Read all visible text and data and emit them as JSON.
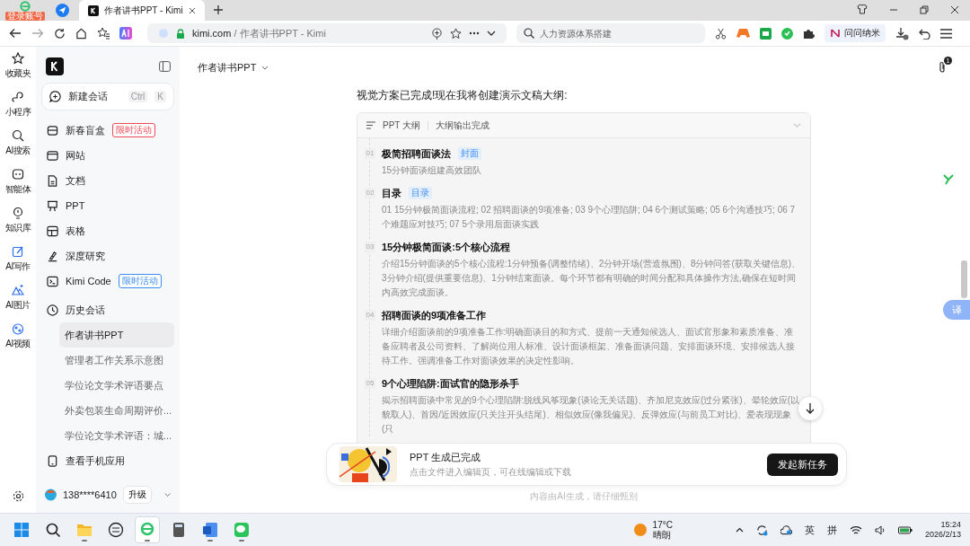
{
  "browser": {
    "tabs": [
      {
        "kind": "icon",
        "badge": "登录账号",
        "selected": false
      },
      {
        "kind": "icon",
        "selected": false
      },
      {
        "kind": "page",
        "label": "作者讲书PPT - Kimi",
        "selected": true
      }
    ],
    "address": {
      "host": "kimi.com",
      "path": " / 作者讲书PPT - Kimi"
    },
    "search": {
      "placeholder": "人力资源体系搭建"
    },
    "extension": "问问纳米"
  },
  "rail": [
    {
      "label": "收藏夹",
      "highlighted": false
    },
    {
      "label": "小程序",
      "highlighted": false
    },
    {
      "label": "AI搜索",
      "highlighted": false
    },
    {
      "label": "智能体",
      "highlighted": false
    },
    {
      "label": "知识库",
      "highlighted": false
    },
    {
      "label": "AI写作",
      "highlighted": true
    },
    {
      "label": "AI图片",
      "highlighted": true
    },
    {
      "label": "AI视频",
      "highlighted": true
    }
  ],
  "sidebar": {
    "new_chat": {
      "label": "新建会话",
      "keys": [
        "Ctrl",
        "K"
      ]
    },
    "nav": [
      {
        "label": "新春盲盒",
        "badge": {
          "text": "限时活动",
          "color": "#f04a5a"
        }
      },
      {
        "label": "网站"
      },
      {
        "label": "文档"
      },
      {
        "label": "PPT"
      },
      {
        "label": "表格"
      },
      {
        "label": "深度研究"
      },
      {
        "label": "Kimi Code",
        "badge": {
          "text": "限时活动",
          "color": "#3b8cf5"
        }
      }
    ],
    "history_label": "历史会话",
    "history": [
      {
        "label": "作者讲书PPT",
        "selected": true
      },
      {
        "label": "管理者工作关系示意图",
        "selected": false
      },
      {
        "label": "学位论文学术评语要点",
        "selected": false
      },
      {
        "label": "外卖包装生命周期评价...",
        "selected": false
      },
      {
        "label": "学位论文学术评语：城...",
        "selected": false
      }
    ],
    "mobile_app": "查看手机应用",
    "user": {
      "name": "138****6410",
      "upgrade": "升级"
    }
  },
  "main": {
    "title": "作者讲书PPT",
    "attachments": "1",
    "message": "视觉方案已完成!现在我将创建演示文稿大纲:",
    "outline": {
      "label": "PPT 大纲",
      "status": "大纲输出完成",
      "items": [
        {
          "number": "01",
          "title": "极简招聘面谈法",
          "tag": "封面",
          "description": "15分钟面谈组建高效团队"
        },
        {
          "number": "02",
          "title": "目录",
          "tag": "目录",
          "description": "01 15分钟极简面谈流程; 02 招聘面谈的9项准备; 03 9个心理陷阱; 04 6个测试策略; 05 6个沟通技巧; 06 7个难题应对技巧; 07 5个录用后面谈实践"
        },
        {
          "number": "03",
          "title": "15分钟极简面谈:5个核心流程",
          "description": "介绍15分钟面谈的5个核心流程:1分钟预备(调整情绪)、2分钟开场(营造氛围)、8分钟问答(获取关键信息)、3分钟介绍(提供重要信息)、1分钟结束面谈。每个环节都有明确的时间分配和具体操作方法,确保在短时间内高效完成面谈。"
        },
        {
          "number": "04",
          "title": "招聘面谈的9项准备工作",
          "description": "详细介绍面谈前的9项准备工作:明确面谈目的和方式、提前一天通知候选人、面试官形象和素质准备、准备应聘者及公司资料、了解岗位用人标准、设计面谈框架、准备面谈问题、安排面谈环境、安排候选人接待工作。强调准备工作对面谈效果的决定性影响。"
        },
        {
          "number": "05",
          "title": "9个心理陷阱:面试官的隐形杀手",
          "description": "揭示招聘面谈中常见的9个心理陷阱:脱线风筝现象(谈论无关话题)、齐加尼克效应(过分紧张)、晕轮效应(以貌取人)、首因/近因效应(只关注开头结尾)、相似效应(像我偏见)、反弹效应(与前员工对比)、爱表现现象(只"
        }
      ]
    },
    "notice": {
      "title": "PPT 生成已完成",
      "subtitle": "点击文件进入编辑页，可在线编辑或下载",
      "button": "发起新任务"
    },
    "footer": "内容由AI生成，请仔细甄别",
    "translate": "译"
  },
  "taskbar": {
    "apps": [
      {
        "running": false,
        "selected": false
      },
      {
        "running": false,
        "selected": false
      },
      {
        "running": true,
        "selected": false
      },
      {
        "running": false,
        "selected": false
      },
      {
        "running": true,
        "selected": true
      },
      {
        "running": false,
        "selected": false
      },
      {
        "running": true,
        "selected": false
      },
      {
        "running": true,
        "selected": false
      }
    ],
    "weather": {
      "temp": "17°C",
      "text": "晴朗"
    },
    "ime": [
      "英",
      "拼"
    ],
    "time": "15:24",
    "date": "2026/2/13"
  }
}
